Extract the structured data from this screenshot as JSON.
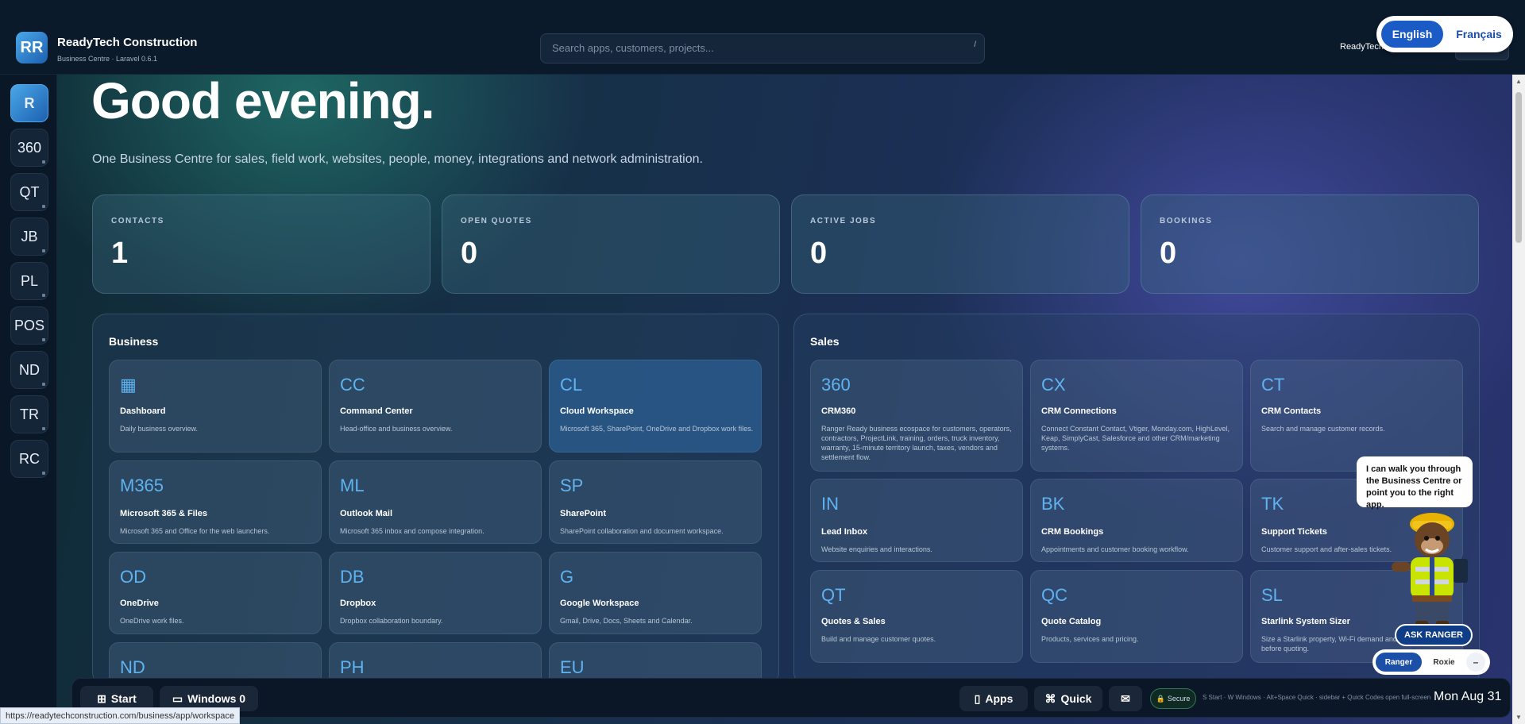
{
  "brand": {
    "logo": "RR",
    "name": "ReadyTech Construction",
    "subtitle": "Business Centre · Laravel 0.6.1"
  },
  "search": {
    "placeholder": "Search apps, customers, projects...",
    "shortcut": "/"
  },
  "top_user": {
    "name": "ReadyTech"
  },
  "language": {
    "options": [
      "English",
      "Français"
    ],
    "selected": "English"
  },
  "sidebar": {
    "items": [
      {
        "label": "R",
        "active": true
      },
      {
        "label": "360"
      },
      {
        "label": "QT"
      },
      {
        "label": "JB"
      },
      {
        "label": "PL"
      },
      {
        "label": "POS"
      },
      {
        "label": "ND"
      },
      {
        "label": "TR"
      },
      {
        "label": "RC"
      }
    ]
  },
  "main": {
    "greeting": "Good evening.",
    "tagline": "One Business Centre for sales, field work, websites, people, money, integrations and network administration."
  },
  "stats": [
    {
      "label": "CONTACTS",
      "value": "1"
    },
    {
      "label": "OPEN QUOTES",
      "value": "0"
    },
    {
      "label": "ACTIVE JOBS",
      "value": "0"
    },
    {
      "label": "BOOKINGS",
      "value": "0"
    }
  ],
  "business": {
    "title": "Business",
    "tiles": [
      {
        "code": "▦",
        "name": "Dashboard",
        "desc": "Daily business overview."
      },
      {
        "code": "CC",
        "name": "Command Center",
        "desc": "Head-office and business overview."
      },
      {
        "code": "CL",
        "name": "Cloud Workspace",
        "desc": "Microsoft 365, SharePoint, OneDrive and Dropbox work files."
      },
      {
        "code": "M365",
        "name": "Microsoft 365 & Files",
        "desc": "Microsoft 365 and Office for the web launchers."
      },
      {
        "code": "ML",
        "name": "Outlook Mail",
        "desc": "Microsoft 365 inbox and compose integration."
      },
      {
        "code": "SP",
        "name": "SharePoint",
        "desc": "SharePoint collaboration and document workspace."
      },
      {
        "code": "OD",
        "name": "OneDrive",
        "desc": "OneDrive work files."
      },
      {
        "code": "DB",
        "name": "Dropbox",
        "desc": "Dropbox collaboration boundary."
      },
      {
        "code": "G",
        "name": "Google Workspace",
        "desc": "Gmail, Drive, Docs, Sheets and Calendar."
      },
      {
        "code": "ND",
        "name": "",
        "desc": ""
      },
      {
        "code": "PH",
        "name": "",
        "desc": ""
      },
      {
        "code": "EU",
        "name": "",
        "desc": ""
      }
    ]
  },
  "sales": {
    "title": "Sales",
    "tiles": [
      {
        "code": "360",
        "name": "CRM360",
        "desc": "Ranger Ready business ecospace for customers, operators, contractors, ProjectLink, training, orders, truck inventory, warranty, 15-minute territory launch, taxes, vendors and settlement flow."
      },
      {
        "code": "CX",
        "name": "CRM Connections",
        "desc": "Connect Constant Contact, Vtiger, Monday.com, HighLevel, Keap, SimplyCast, Salesforce and other CRM/marketing systems."
      },
      {
        "code": "CT",
        "name": "CRM Contacts",
        "desc": "Search and manage customer records."
      },
      {
        "code": "IN",
        "name": "Lead Inbox",
        "desc": "Website enquiries and interactions."
      },
      {
        "code": "BK",
        "name": "CRM Bookings",
        "desc": "Appointments and customer booking workflow."
      },
      {
        "code": "TK",
        "name": "Support Tickets",
        "desc": "Customer support and after-sales tickets."
      },
      {
        "code": "QT",
        "name": "Quotes & Sales",
        "desc": "Build and manage customer quotes."
      },
      {
        "code": "QC",
        "name": "Quote Catalog",
        "desc": "Products, services and pricing."
      },
      {
        "code": "SL",
        "name": "Starlink System Sizer",
        "desc": "Size a Starlink property, Wi-Fi demand and requirement before quoting."
      }
    ]
  },
  "taskbar": {
    "start": "Start",
    "windows": "Windows 0",
    "apps": "Apps",
    "quick": "Quick",
    "secure": "Secure",
    "hint": "S Start · W Windows · Alt+Space Quick · sidebar + Quick Codes open full-screen",
    "date": "Mon Aug 31"
  },
  "assistant": {
    "message": "I can walk you through the Business Centre or point you to the right app.",
    "ask_label": "ASK RANGER",
    "personas": [
      "Ranger",
      "Roxie"
    ],
    "minimize": "–"
  },
  "status_url": "https://readytechconstruction.com/business/app/workspace",
  "colors": {
    "accent": "#5fb3f0",
    "primary": "#1b5bc6",
    "secure": "#2f7a55"
  }
}
